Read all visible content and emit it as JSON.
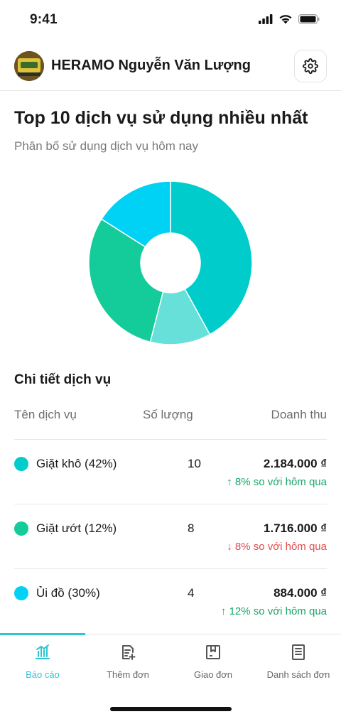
{
  "status": {
    "time": "9:41"
  },
  "header": {
    "title": "HERAMO Nguyễn Văn Lượng"
  },
  "overview": {
    "title": "Top 10 dịch vụ sử dụng nhiều nhất",
    "subtitle": "Phân bố sử dụng dịch vụ hôm nay"
  },
  "chart_data": {
    "type": "pie",
    "donut": true,
    "slices": [
      {
        "label": "Giặt khô",
        "value": 42,
        "color": "#00CCCC"
      },
      {
        "label": "Giặt ướt",
        "value": 12,
        "color": "#66E0D9"
      },
      {
        "label": "Ủi đồ",
        "value": 30,
        "color": "#14CC9A"
      },
      {
        "label": "",
        "value": 16,
        "color": "#00D2F5"
      }
    ]
  },
  "details": {
    "title": "Chi tiết dịch vụ",
    "columns": {
      "name": "Tên dịch vụ",
      "qty": "Số lượng",
      "revenue": "Doanh thu"
    },
    "rows": [
      {
        "name": "Giặt khô (42%)",
        "qty": "10",
        "revenue": "2.184.000 ₫",
        "change": "↑ 8% so với hôm qua",
        "trend": "up",
        "color": "#00CCCC"
      },
      {
        "name": "Giặt ướt (12%)",
        "qty": "8",
        "revenue": "1.716.000 ₫",
        "change": "↓ 8% so với hôm qua",
        "trend": "down",
        "color": "#14CC9A"
      },
      {
        "name": "Ủi đồ (30%)",
        "qty": "4",
        "revenue": "884.000 ₫",
        "change": "↑ 12% so với hôm qua",
        "trend": "up",
        "color": "#00D2F5"
      }
    ]
  },
  "tabs": [
    {
      "label": "Báo cáo",
      "icon": "chart-bars-icon",
      "active": true
    },
    {
      "label": "Thêm đơn",
      "icon": "add-document-icon",
      "active": false
    },
    {
      "label": "Giao đơn",
      "icon": "box-icon",
      "active": false
    },
    {
      "label": "Danh sách đơn",
      "icon": "document-list-icon",
      "active": false
    }
  ],
  "colors": {
    "accent": "#2CC6D1",
    "up": "#18A66A",
    "down": "#E24A4A"
  }
}
